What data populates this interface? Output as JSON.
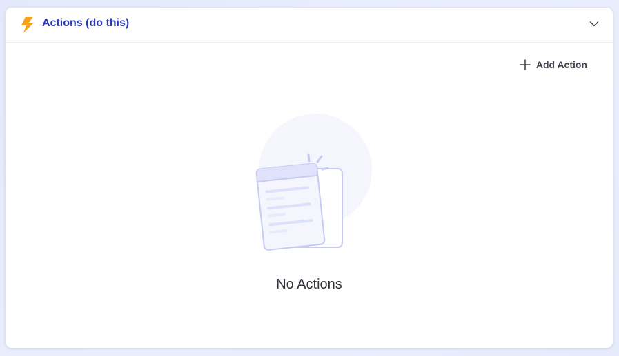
{
  "panel": {
    "title": "Actions (do this)",
    "title_color": "#2a3bb8",
    "icon": "lightning-bolt-icon",
    "icon_color": "#f7a21b",
    "expanded": true
  },
  "toolbar": {
    "add_action_label": "Add Action"
  },
  "empty_state": {
    "message": "No Actions",
    "illustration": "empty-documents-illustration"
  }
}
